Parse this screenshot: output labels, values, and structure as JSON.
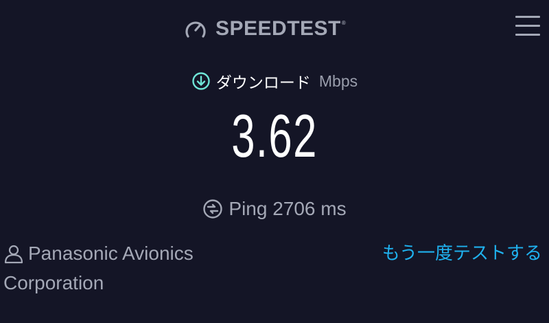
{
  "header": {
    "brand_name": "SPEEDTEST",
    "brand_tm": "®",
    "brand_icon": "speedometer-icon",
    "menu_icon": "hamburger-menu-icon"
  },
  "result": {
    "download_label": "ダウンロード",
    "download_icon": "arrow-down-circle-icon",
    "unit": "Mbps",
    "download_value": "3.62",
    "ping_icon": "ping-circle-icon",
    "ping_text": "Ping 2706 ms"
  },
  "provider": {
    "icon": "person-icon",
    "name_line1": "Panasonic Avionics",
    "name_line2": "Corporation"
  },
  "actions": {
    "retest_label": "もう一度テストする"
  },
  "colors": {
    "background": "#141526",
    "download_accent": "#6ee4d6",
    "link": "#1fb1ee",
    "muted_text": "#a4a8b6"
  }
}
